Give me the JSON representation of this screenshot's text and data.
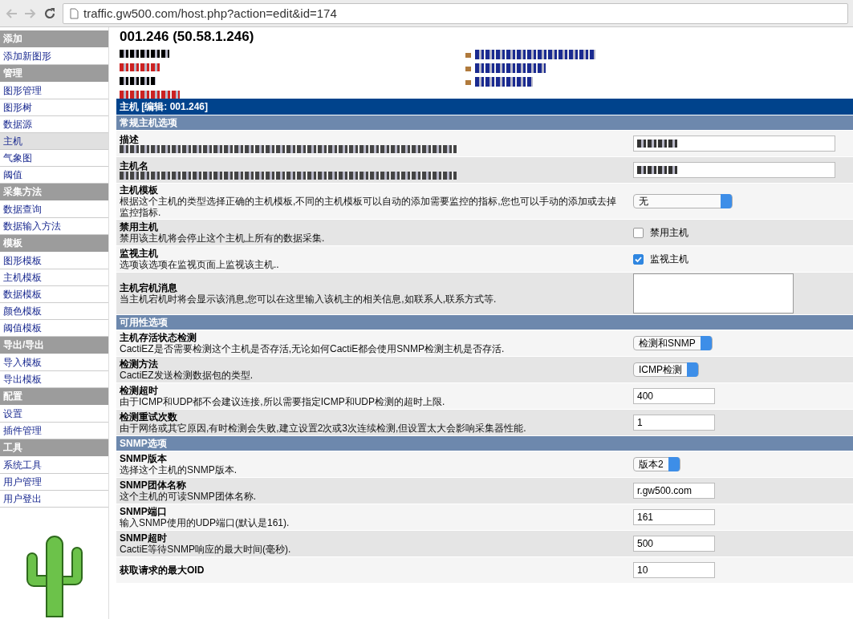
{
  "browser": {
    "url": "traffic.gw500.com/host.php?action=edit&id=174"
  },
  "sidebar": {
    "sections": [
      {
        "title": "添加",
        "items": [
          {
            "label": "添加新图形",
            "selected": false
          }
        ]
      },
      {
        "title": "管理",
        "items": [
          {
            "label": "图形管理",
            "selected": false
          },
          {
            "label": "图形树",
            "selected": false
          },
          {
            "label": "数据源",
            "selected": false
          },
          {
            "label": "主机",
            "selected": true
          },
          {
            "label": "气象图",
            "selected": false
          },
          {
            "label": "阈值",
            "selected": false
          }
        ]
      },
      {
        "title": "采集方法",
        "items": [
          {
            "label": "数据查询",
            "selected": false
          },
          {
            "label": "数据输入方法",
            "selected": false
          }
        ]
      },
      {
        "title": "模板",
        "items": [
          {
            "label": "图形模板",
            "selected": false
          },
          {
            "label": "主机模板",
            "selected": false
          },
          {
            "label": "数据模板",
            "selected": false
          },
          {
            "label": "颜色模板",
            "selected": false
          },
          {
            "label": "阈值模板",
            "selected": false
          }
        ]
      },
      {
        "title": "导出/导出",
        "items": [
          {
            "label": "导入模板",
            "selected": false
          },
          {
            "label": "导出模板",
            "selected": false
          }
        ]
      },
      {
        "title": "配置",
        "items": [
          {
            "label": "设置",
            "selected": false
          },
          {
            "label": "插件管理",
            "selected": false
          }
        ]
      },
      {
        "title": "工具",
        "items": [
          {
            "label": "系统工具",
            "selected": false
          },
          {
            "label": "用户管理",
            "selected": false
          },
          {
            "label": "用户登出",
            "selected": false
          }
        ]
      }
    ]
  },
  "host": {
    "title": "001.246 (50.58.1.246)",
    "info_lines": [
      {
        "color": "#000000"
      },
      {
        "color": "#cc2222"
      },
      {
        "color": "#000000"
      },
      {
        "color": "#cc2222"
      }
    ],
    "links": [
      {
        "redacted": true
      },
      {
        "redacted": true
      },
      {
        "redacted": true
      }
    ]
  },
  "panel": {
    "title": "主机 [编辑: 001.246]",
    "sections": [
      {
        "title": "常规主机选项",
        "rows": [
          {
            "label": "描述",
            "redacted": true,
            "kind": "text",
            "wide": true
          },
          {
            "label": "主机名",
            "redacted": true,
            "kind": "text",
            "wide": true
          },
          {
            "label": "主机模板",
            "description": "根据这个主机的类型选择正确的主机模板,不同的主机模板可以自动的添加需要监控的指标,您也可以手动的添加或去掉监控指标.",
            "kind": "select",
            "value": "无",
            "wide": true
          },
          {
            "label": "禁用主机",
            "description": "禁用该主机将会停止这个主机上所有的数据采集.",
            "kind": "checkbox",
            "checked": false,
            "check_label": "禁用主机"
          },
          {
            "label": "监视主机",
            "description": "选项该选项在监视页面上监视该主机..",
            "kind": "checkbox",
            "checked": true,
            "check_label": "监视主机"
          },
          {
            "label": "主机宕机消息",
            "description": "当主机宕机时将会显示该消息,您可以在这里输入该机主的相关信息,如联系人,联系方式等.",
            "kind": "textarea"
          }
        ]
      },
      {
        "title": "可用性选项",
        "rows": [
          {
            "label": "主机存活状态检测",
            "description": "CactiEZ是否需要检测这个主机是否存活,无论如何CactiE都会使用SNMP检测主机是否存活.",
            "kind": "select",
            "value": "检测和SNMP"
          },
          {
            "label": "检测方法",
            "description": "CactiEZ发送检测数据包的类型.",
            "kind": "select",
            "value": "ICMP检测"
          },
          {
            "label": "检测超时",
            "description": "由于ICMP和UDP都不会建议连接,所以需要指定ICMP和UDP检测的超时上限.",
            "kind": "text",
            "value": "400"
          },
          {
            "label": "检测重试次数",
            "description": "由于网络或其它原因,有时检测会失败,建立设置2次或3次连续检测,但设置太大会影响采集器性能.",
            "kind": "text",
            "value": "1"
          }
        ]
      },
      {
        "title": "SNMP选项",
        "rows": [
          {
            "label": "SNMP版本",
            "description": "选择这个主机的SNMP版本.",
            "kind": "select",
            "value": "版本2"
          },
          {
            "label": "SNMP团体名称",
            "description": "这个主机的可读SNMP团体名称.",
            "kind": "text",
            "value": "r.gw500.com"
          },
          {
            "label": "SNMP端口",
            "description": "输入SNMP使用的UDP端口(默认是161).",
            "kind": "text",
            "value": "161"
          },
          {
            "label": "SNMP超时",
            "description": "CactiE等待SNMP响应的最大时间(毫秒).",
            "kind": "text",
            "value": "500"
          },
          {
            "label": "获取请求的最大OID",
            "kind": "text",
            "value": "10"
          }
        ]
      }
    ]
  }
}
